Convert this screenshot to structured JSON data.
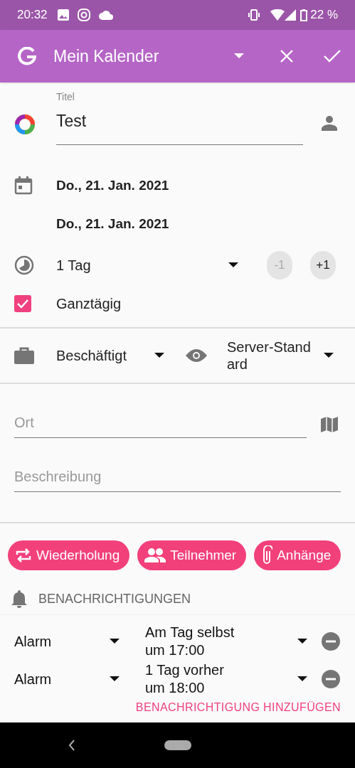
{
  "status_bar": {
    "time": "20:32",
    "battery": "22 %"
  },
  "app_bar": {
    "calendar": "Mein Kalender"
  },
  "title_field": {
    "label": "Titel",
    "value": "Test"
  },
  "start_date": "Do., 21. Jan. 2021",
  "end_date": "Do., 21. Jan. 2021",
  "duration": {
    "value": "1 Tag",
    "buttons": [
      {
        "label": "-1",
        "disabled": true
      },
      {
        "label": "+1",
        "disabled": false
      }
    ]
  },
  "all_day": {
    "label": "Ganztägig",
    "checked": true
  },
  "availability": "Beschäftigt",
  "visibility": "Server-Stand ard",
  "location_field": {
    "placeholder": "Ort"
  },
  "description_field": {
    "placeholder": "Beschreibung"
  },
  "chips": [
    {
      "kind": "repeat",
      "label": "Wiederholung"
    },
    {
      "kind": "people",
      "label": "Teilnehmer"
    },
    {
      "kind": "attach",
      "label": "Anhänge"
    }
  ],
  "notifications": {
    "heading": "BENACHRICHTIGUNGEN",
    "items": [
      {
        "type": "Alarm",
        "when": "Am Tag selbst um 17:00"
      },
      {
        "type": "Alarm",
        "when": "1 Tag vorher um 18:00"
      }
    ],
    "add_button": "BENACHRICHTIGUNG HINZUFÜGEN"
  }
}
